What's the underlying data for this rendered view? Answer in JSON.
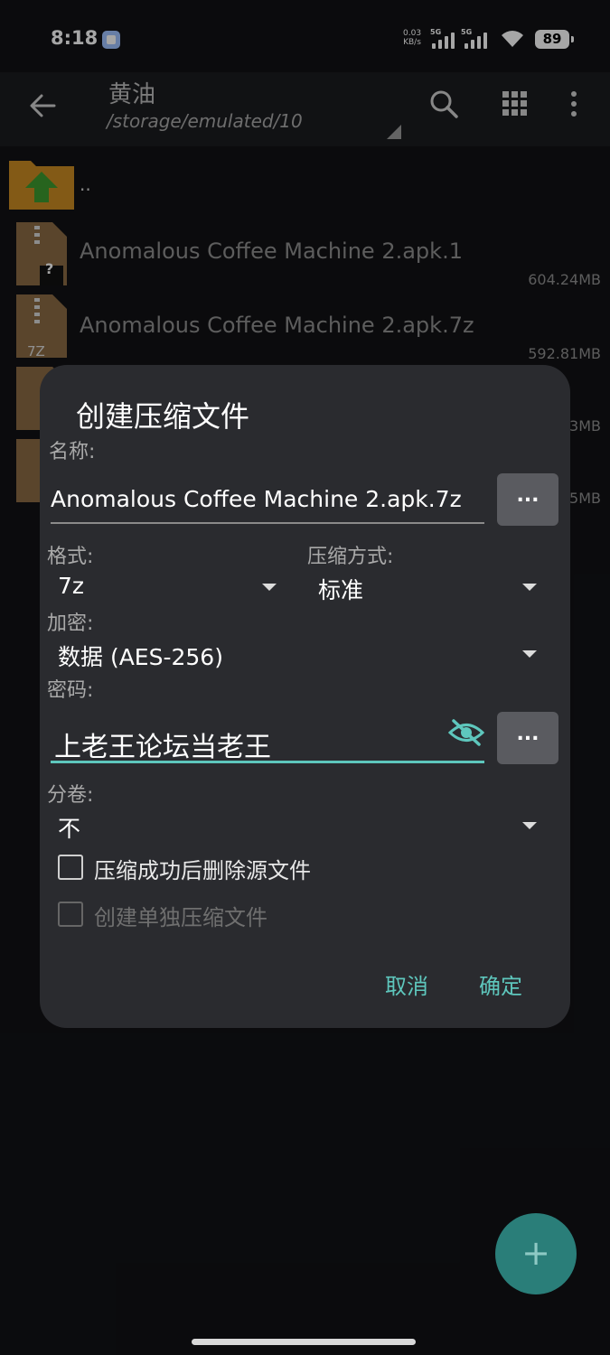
{
  "status": {
    "time": "8:18",
    "net_speed_value": "0.03",
    "net_speed_unit": "KB/s",
    "sim1_gen": "5G",
    "sim2_gen": "5G",
    "battery": "89"
  },
  "appbar": {
    "title": "黄油",
    "path": "/storage/emulated/10"
  },
  "files": [
    {
      "name": "..",
      "size": ""
    },
    {
      "name": "Anomalous Coffee Machine 2.apk.1",
      "size": "604.24MB",
      "badge": "?"
    },
    {
      "name": "Anomalous Coffee Machine 2.apk.7z",
      "size": "592.81MB",
      "badge": "7Z"
    },
    {
      "name": "",
      "size": "3MB"
    },
    {
      "name": "",
      "size": "5MB"
    }
  ],
  "dialog": {
    "title": "创建压缩文件",
    "name_label": "名称:",
    "name_value": "Anomalous Coffee Machine 2.apk.7z",
    "dots_label": "...",
    "format_label": "格式:",
    "format_value": "7z",
    "method_label": "压缩方式:",
    "method_value": "标准",
    "encrypt_label": "加密:",
    "encrypt_value": "数据 (AES-256)",
    "password_label": "密码:",
    "password_value": "上老王论坛当老王",
    "volume_label": "分卷:",
    "volume_value": "不",
    "delete_after_label": "压缩成功后删除源文件",
    "delete_after_checked": false,
    "separate_label": "创建单独压缩文件",
    "separate_checked": false,
    "cancel_label": "取消",
    "ok_label": "确定"
  },
  "fab": {
    "label": "+"
  },
  "colors": {
    "accent": "#5ec7bd",
    "fab": "#2a7e79",
    "dialog_bg": "#2a2b2f"
  }
}
